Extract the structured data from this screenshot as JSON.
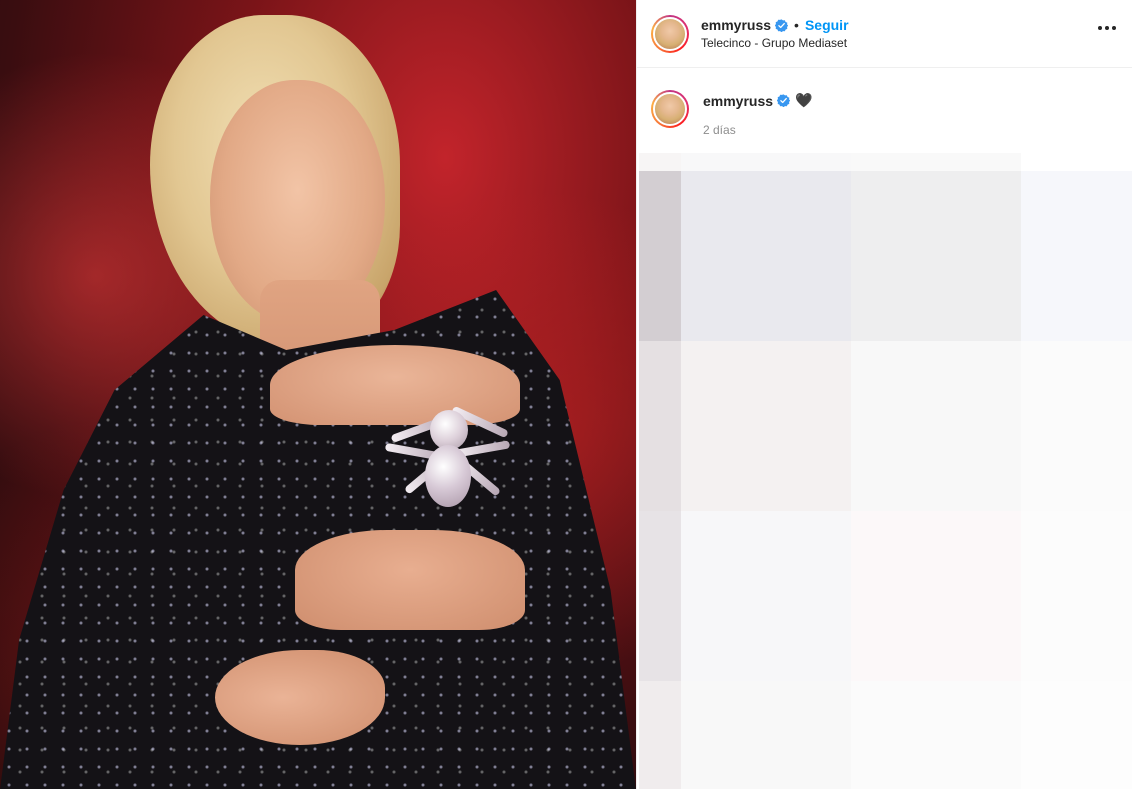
{
  "post": {
    "author": {
      "username": "emmyruss",
      "verified": true,
      "location": "Telecinco - Grupo Mediaset"
    },
    "follow_label": "Seguir",
    "separator": "•",
    "caption": {
      "username": "emmyruss",
      "text": "🖤",
      "time": "2 días"
    },
    "icons": {
      "verified": "verified-badge-icon",
      "more": "more-options-icon",
      "heart": "black-heart-emoji"
    },
    "colors": {
      "follow": "#0095f6",
      "verified": "#3897f0",
      "text": "#262626",
      "muted": "#8e8e8e"
    }
  }
}
